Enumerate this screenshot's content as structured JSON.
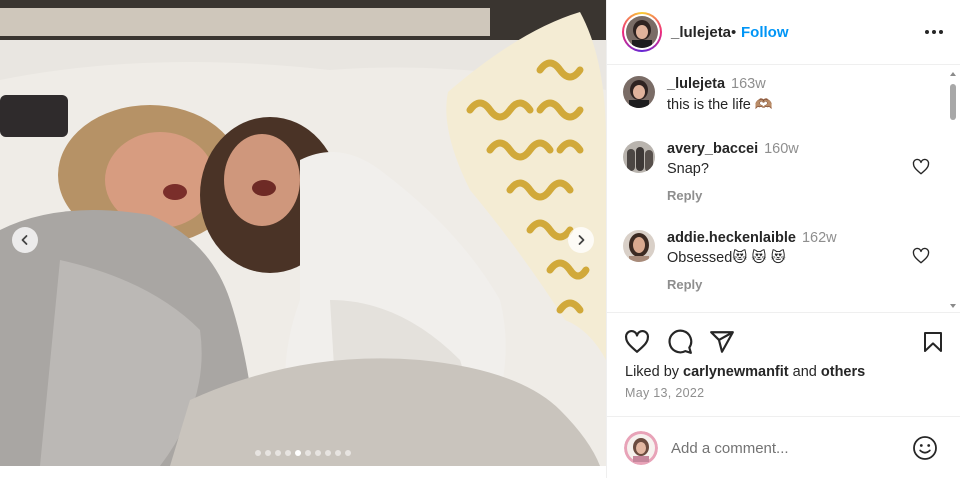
{
  "post": {
    "image_alt": "Two women laughing while lying on a hotel bed",
    "carousel": {
      "slide_count": 10,
      "active_slide": 5
    }
  },
  "header": {
    "username": "_lulejeta",
    "separator": "•",
    "follow_label": "Follow"
  },
  "comments": [
    {
      "username": "_lulejeta",
      "time": "163w",
      "text": "this is the life 🫶🏽",
      "is_caption": true
    },
    {
      "username": "avery_baccei",
      "time": "160w",
      "text": "Snap?",
      "reply_label": "Reply"
    },
    {
      "username": "addie.heckenlaible",
      "time": "162w",
      "text": "Obsessed😻 😻 😻",
      "reply_label": "Reply"
    }
  ],
  "actions": {
    "liked_by_prefix": "Liked by",
    "liked_by_user": "carlynewmanfit",
    "liked_by_and": "and",
    "liked_by_others": "others",
    "date": "May 13, 2022"
  },
  "add_comment": {
    "placeholder": "Add a comment..."
  },
  "icons": {
    "more": "more-horizontal-icon",
    "like": "heart-icon",
    "comment": "comment-icon",
    "share": "send-icon",
    "save": "bookmark-icon",
    "emoji": "emoji-icon",
    "prev": "chevron-left-icon",
    "next": "chevron-right-icon"
  },
  "colors": {
    "accent": "#0095f6",
    "text": "#262626",
    "muted": "#8e8e8e",
    "divider": "#efefef"
  }
}
